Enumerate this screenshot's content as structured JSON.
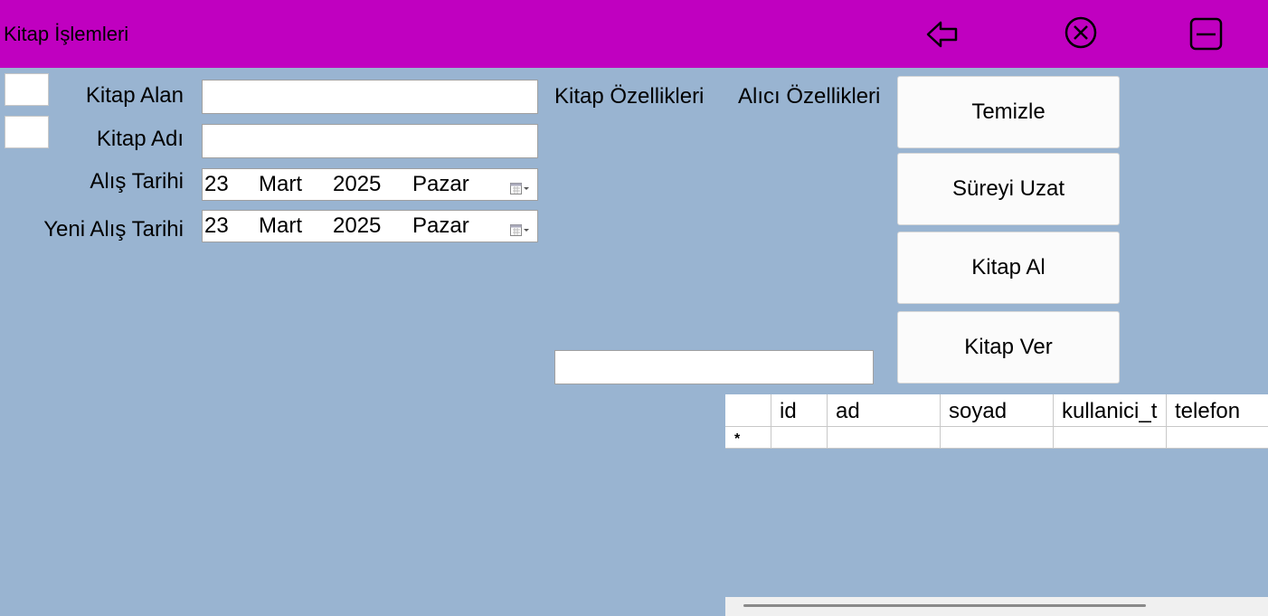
{
  "window": {
    "title": "Kitap İşlemleri",
    "accent_color": "#c000c0",
    "background_color": "#99b4d1",
    "icons": [
      "back-arrow-icon",
      "close-circle-icon",
      "minimize-icon"
    ]
  },
  "form": {
    "kitap_alan_label": "Kitap Alan",
    "kitap_adi_label": "Kitap Adı",
    "alis_tarihi_label": "Alış Tarihi",
    "yeni_alis_tarihi_label": "Yeni Alış Tarihi",
    "kitap_alan_value": "",
    "kitap_adi_value": "",
    "alis_tarihi": {
      "day": "23",
      "month": "Mart",
      "year": "2025",
      "weekday": "Pazar"
    },
    "yeni_alis_tarihi": {
      "day": "23",
      "month": "Mart",
      "year": "2025",
      "weekday": "Pazar"
    }
  },
  "sections": {
    "kitap_ozellikleri": "Kitap Özellikleri",
    "alici_ozellikleri": "Alıcı Özellikleri",
    "search_value": ""
  },
  "buttons": {
    "temizle": "Temizle",
    "sureyi_uzat": "Süreyi Uzat",
    "kitap_al": "Kitap Al",
    "kitap_ver": "Kitap Ver"
  },
  "grid": {
    "columns": [
      "id",
      "ad",
      "soyad",
      "kullanici_t",
      "telefon"
    ],
    "new_row_marker": "*"
  }
}
